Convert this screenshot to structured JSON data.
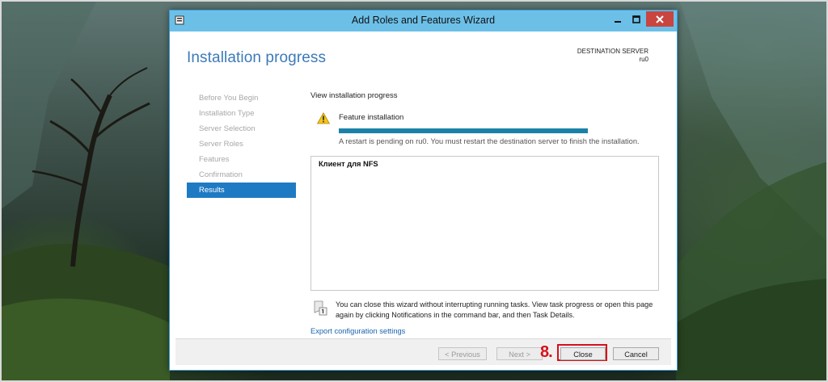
{
  "window": {
    "title": "Add Roles and Features Wizard",
    "accent_color": "#6cc0e8",
    "close_color": "#c9453f"
  },
  "page": {
    "title": "Installation progress",
    "destination_label": "DESTINATION SERVER",
    "destination_server": "ru0"
  },
  "nav": {
    "items": [
      {
        "label": "Before You Begin",
        "active": false
      },
      {
        "label": "Installation Type",
        "active": false
      },
      {
        "label": "Server Selection",
        "active": false
      },
      {
        "label": "Server Roles",
        "active": false
      },
      {
        "label": "Features",
        "active": false
      },
      {
        "label": "Confirmation",
        "active": false
      },
      {
        "label": "Results",
        "active": true
      }
    ],
    "active_color": "#1f7ac4"
  },
  "content": {
    "heading": "View installation progress",
    "feature_label": "Feature installation",
    "progress": 1.0,
    "progress_color": "#1a82a8",
    "restart_message": "A restart is pending on ru0. You must restart the destination server to finish the installation.",
    "results_items": [
      "Клиент для NFS"
    ],
    "info_text": "You can close this wizard without interrupting running tasks. View task progress or open this page again by clicking Notifications in the command bar, and then Task Details.",
    "export_link": "Export configuration settings"
  },
  "footer": {
    "previous_label": "< Previous",
    "next_label": "Next >",
    "close_label": "Close",
    "cancel_label": "Cancel",
    "annotation_step": "8.",
    "annotation_color": "#d6111d"
  },
  "icons": {
    "app": "server-manager-icon",
    "minimize": "minimize-icon",
    "maximize": "maximize-icon",
    "close": "close-icon",
    "warning": "warning-icon",
    "info": "notification-flag-icon"
  }
}
